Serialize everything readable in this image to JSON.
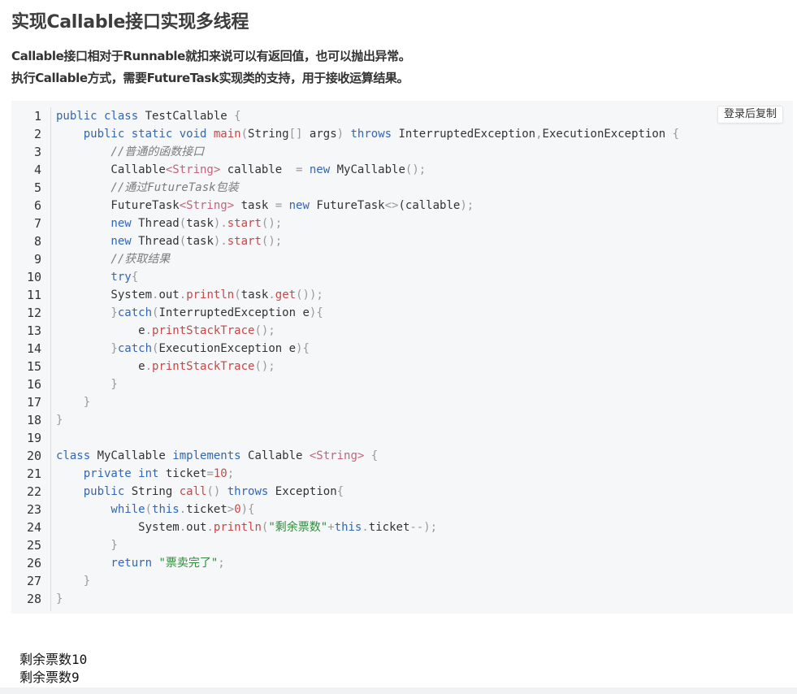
{
  "title": "实现Callable接口实现多线程",
  "description": [
    "Callable接口相对于Runnable就扣来说可以有返回值，也可以抛出异常。",
    "执行Callable方式，需要FutureTask实现类的支持，用于接收运算结果。"
  ],
  "copy_button": "登录后复制",
  "line_numbers": [
    "1",
    "2",
    "3",
    "4",
    "5",
    "6",
    "7",
    "8",
    "9",
    "10",
    "11",
    "12",
    "13",
    "14",
    "15",
    "16",
    "17",
    "18",
    "19",
    "20",
    "21",
    "22",
    "23",
    "24",
    "25",
    "26",
    "27",
    "28"
  ],
  "code": {
    "l1": [
      [
        "public class ",
        "kw"
      ],
      [
        "TestCallable ",
        ""
      ],
      [
        "{",
        "pu"
      ]
    ],
    "l2": [
      [
        "    public static void ",
        "kw"
      ],
      [
        "main",
        "fn"
      ],
      [
        "(",
        "pu"
      ],
      [
        "String",
        ""
      ],
      [
        "[] ",
        "pu"
      ],
      [
        "args",
        ""
      ],
      [
        ") ",
        "pu"
      ],
      [
        "throws ",
        "kw"
      ],
      [
        "InterruptedException",
        ""
      ],
      [
        ",",
        "pu"
      ],
      [
        "ExecutionException ",
        ""
      ],
      [
        "{",
        "pu"
      ]
    ],
    "l3": [
      [
        "        //普通的函数接口",
        "cm"
      ]
    ],
    "l4": [
      [
        "        Callable",
        ""
      ],
      [
        "<String>",
        "ty"
      ],
      [
        " callable  ",
        ""
      ],
      [
        "= ",
        "pu"
      ],
      [
        "new ",
        "kw"
      ],
      [
        "MyCallable",
        ""
      ],
      [
        "();",
        "pu"
      ]
    ],
    "l5": [
      [
        "        //通过FutureTask包装",
        "cm"
      ]
    ],
    "l6": [
      [
        "        FutureTask",
        ""
      ],
      [
        "<String>",
        "ty"
      ],
      [
        " task ",
        ""
      ],
      [
        "= ",
        "pu"
      ],
      [
        "new ",
        "kw"
      ],
      [
        "FutureTask",
        ""
      ],
      [
        "<>",
        "pu"
      ],
      [
        "(callable",
        ""
      ],
      [
        ");",
        "pu"
      ]
    ],
    "l7": [
      [
        "        new ",
        "kw"
      ],
      [
        "Thread",
        ""
      ],
      [
        "(",
        "pu"
      ],
      [
        "task",
        ""
      ],
      [
        ").",
        "pu"
      ],
      [
        "start",
        "fn"
      ],
      [
        "();",
        "pu"
      ]
    ],
    "l8": [
      [
        "        new ",
        "kw"
      ],
      [
        "Thread",
        ""
      ],
      [
        "(",
        "pu"
      ],
      [
        "task",
        ""
      ],
      [
        ").",
        "pu"
      ],
      [
        "start",
        "fn"
      ],
      [
        "();",
        "pu"
      ]
    ],
    "l9": [
      [
        "        //获取结果",
        "cm"
      ]
    ],
    "l10": [
      [
        "        try",
        "kw"
      ],
      [
        "{",
        "pu"
      ]
    ],
    "l11": [
      [
        "        System",
        ""
      ],
      [
        ".",
        "pu"
      ],
      [
        "out",
        ""
      ],
      [
        ".",
        "pu"
      ],
      [
        "println",
        "fn"
      ],
      [
        "(",
        "pu"
      ],
      [
        "task",
        ""
      ],
      [
        ".",
        "pu"
      ],
      [
        "get",
        "fn"
      ],
      [
        "());",
        "pu"
      ]
    ],
    "l12": [
      [
        "        }",
        "pu"
      ],
      [
        "catch",
        "kw"
      ],
      [
        "(",
        "pu"
      ],
      [
        "InterruptedException e",
        ""
      ],
      [
        "){",
        "pu"
      ]
    ],
    "l13": [
      [
        "            e",
        ""
      ],
      [
        ".",
        "pu"
      ],
      [
        "printStackTrace",
        "fn"
      ],
      [
        "();",
        "pu"
      ]
    ],
    "l14": [
      [
        "        }",
        "pu"
      ],
      [
        "catch",
        "kw"
      ],
      [
        "(",
        "pu"
      ],
      [
        "ExecutionException e",
        ""
      ],
      [
        "){",
        "pu"
      ]
    ],
    "l15": [
      [
        "            e",
        ""
      ],
      [
        ".",
        "pu"
      ],
      [
        "printStackTrace",
        "fn"
      ],
      [
        "();",
        "pu"
      ]
    ],
    "l16": [
      [
        "        }",
        "pu"
      ]
    ],
    "l17": [
      [
        "    }",
        "pu"
      ]
    ],
    "l18": [
      [
        "}",
        "pu"
      ]
    ],
    "l19": [
      [
        "",
        ""
      ]
    ],
    "l20": [
      [
        "class ",
        "kw"
      ],
      [
        "MyCallable ",
        ""
      ],
      [
        "implements ",
        "kw"
      ],
      [
        "Callable ",
        ""
      ],
      [
        "<String>",
        "ty"
      ],
      [
        " {",
        "pu"
      ]
    ],
    "l21": [
      [
        "    private int ",
        "kw"
      ],
      [
        "ticket",
        ""
      ],
      [
        "=",
        "pu"
      ],
      [
        "10",
        "nu"
      ],
      [
        ";",
        "pu"
      ]
    ],
    "l22": [
      [
        "    public ",
        "kw"
      ],
      [
        "String ",
        ""
      ],
      [
        "call",
        "fn"
      ],
      [
        "() ",
        "pu"
      ],
      [
        "throws ",
        "kw"
      ],
      [
        "Exception",
        ""
      ],
      [
        "{",
        "pu"
      ]
    ],
    "l23": [
      [
        "        while",
        "kw"
      ],
      [
        "(",
        "pu"
      ],
      [
        "this",
        "kw"
      ],
      [
        ".",
        "pu"
      ],
      [
        "ticket",
        ""
      ],
      [
        ">",
        "pu"
      ],
      [
        "0",
        "nu"
      ],
      [
        "){",
        "pu"
      ]
    ],
    "l24": [
      [
        "            System",
        ""
      ],
      [
        ".",
        "pu"
      ],
      [
        "out",
        ""
      ],
      [
        ".",
        "pu"
      ],
      [
        "println",
        "fn"
      ],
      [
        "(",
        "pu"
      ],
      [
        "\"剩余票数\"",
        "st"
      ],
      [
        "+",
        "pu"
      ],
      [
        "this",
        "kw"
      ],
      [
        ".",
        "pu"
      ],
      [
        "ticket",
        ""
      ],
      [
        "--);",
        "pu"
      ]
    ],
    "l25": [
      [
        "        }",
        "pu"
      ]
    ],
    "l26": [
      [
        "        return ",
        "kw"
      ],
      [
        "\"票卖完了\"",
        "st"
      ],
      [
        ";",
        "pu"
      ]
    ],
    "l27": [
      [
        "    }",
        "pu"
      ]
    ],
    "l28": [
      [
        "}",
        "pu"
      ]
    ]
  },
  "output": [
    "剩余票数10",
    "剩余票数9"
  ]
}
